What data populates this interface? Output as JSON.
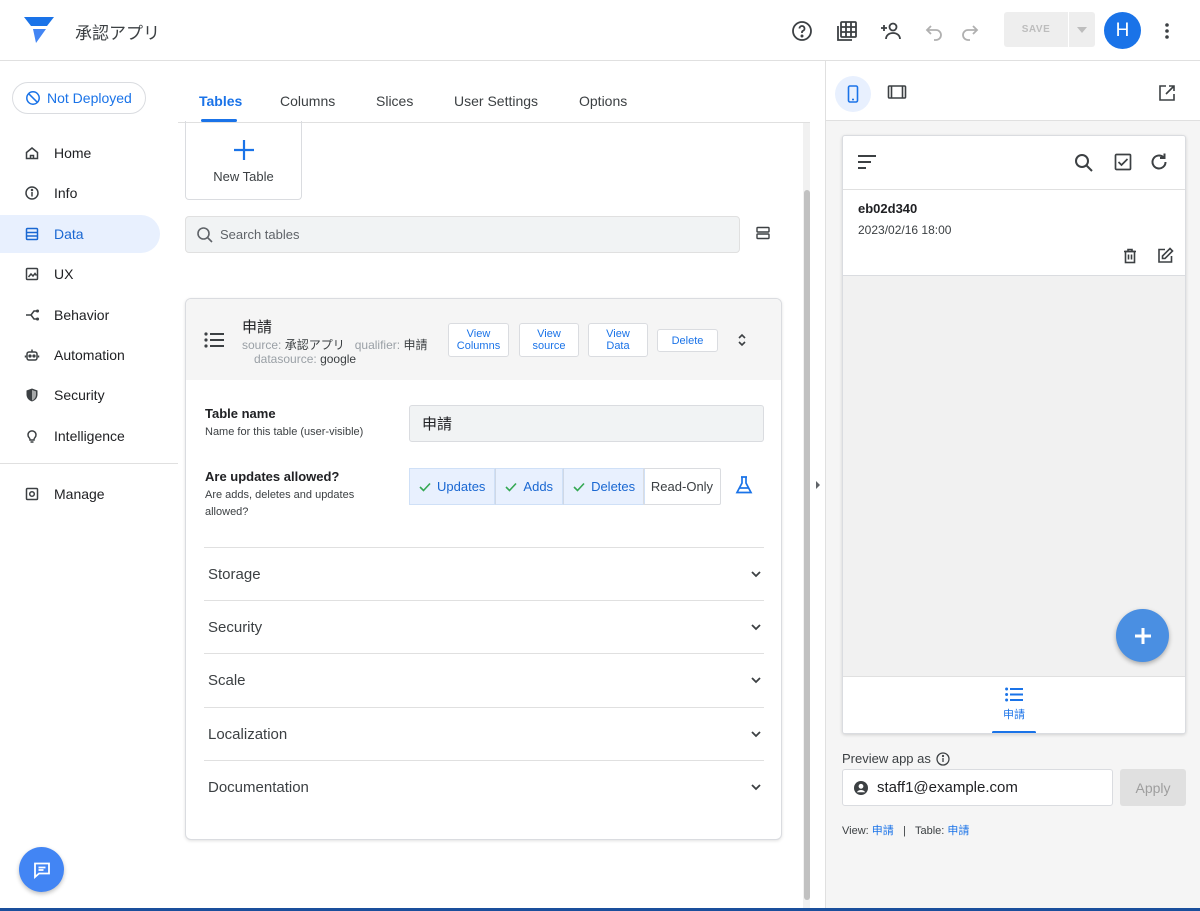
{
  "app": {
    "title": "承認アプリ"
  },
  "toolbar": {
    "save_label": "SAVE",
    "avatar_initial": "H"
  },
  "deploy": {
    "status": "Not Deployed"
  },
  "nav": {
    "items": [
      {
        "label": "Home",
        "icon": "home-icon"
      },
      {
        "label": "Info",
        "icon": "info-icon"
      },
      {
        "label": "Data",
        "icon": "data-icon",
        "active": true
      },
      {
        "label": "UX",
        "icon": "ux-icon"
      },
      {
        "label": "Behavior",
        "icon": "behavior-icon"
      },
      {
        "label": "Automation",
        "icon": "automation-icon"
      },
      {
        "label": "Security",
        "icon": "security-icon"
      },
      {
        "label": "Intelligence",
        "icon": "intelligence-icon"
      }
    ],
    "manage_label": "Manage"
  },
  "tabs": [
    {
      "label": "Tables",
      "active": true
    },
    {
      "label": "Columns"
    },
    {
      "label": "Slices"
    },
    {
      "label": "User Settings"
    },
    {
      "label": "Options"
    }
  ],
  "new_table": {
    "label": "New Table"
  },
  "search": {
    "placeholder": "Search tables"
  },
  "table": {
    "name": "申請",
    "meta": {
      "source_label": "source:",
      "source_value": "承認アプリ",
      "qualifier_label": "qualifier:",
      "qualifier_value": "申請",
      "datasource_label": "datasource:",
      "datasource_value": "google"
    },
    "buttons": {
      "view_columns_1": "View",
      "view_columns_2": "Columns",
      "view_source_1": "View",
      "view_source_2": "source",
      "view_data_1": "View",
      "view_data_2": "Data",
      "delete": "Delete"
    },
    "fields": {
      "table_name_label": "Table name",
      "table_name_desc": "Name for this table (user-visible)",
      "table_name_value": "申請",
      "updates_label": "Are updates allowed?",
      "updates_desc": "Are adds, deletes and updates allowed?",
      "update_options": [
        "Updates",
        "Adds",
        "Deletes"
      ],
      "readonly_label": "Read-Only"
    },
    "sections": [
      "Storage",
      "Security",
      "Scale",
      "Localization",
      "Documentation"
    ]
  },
  "preview": {
    "record_id": "eb02d340",
    "record_date": "2023/02/16 18:00",
    "nav_label": "申請",
    "preview_as_label": "Preview app as",
    "user_email": "staff1@example.com",
    "apply_label": "Apply",
    "view_label": "View:",
    "view_value": "申請",
    "separator": "|",
    "table_label": "Table:",
    "table_value": "申請"
  },
  "colors": {
    "accent": "#1a73e8",
    "active_bg": "#e8f0fe"
  }
}
